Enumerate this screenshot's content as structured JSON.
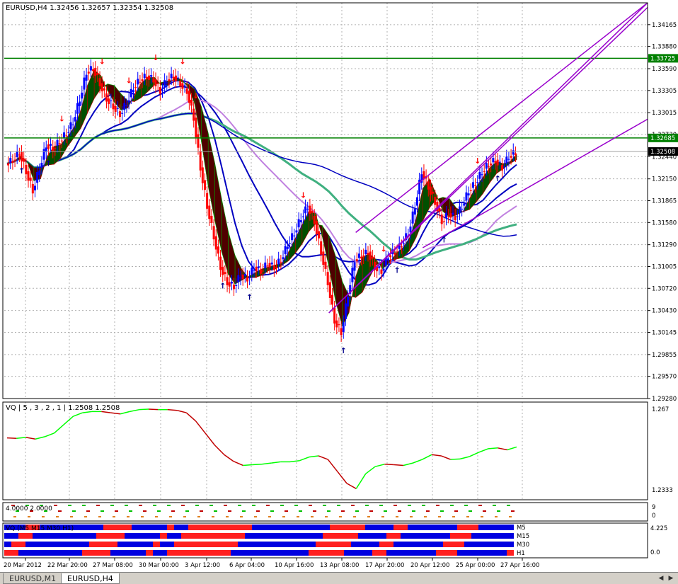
{
  "header": {
    "main_title": "EURUSD,H4  1.32456 1.32657 1.32354 1.32508",
    "vq_title": "VQ | 5 , 3 , 2 , 1 | 1.2508 1.2508",
    "dots_title": "4.0000 2.0000",
    "mtf_title": "VQ (M5 M15 M30 H1)"
  },
  "chart_data": {
    "type": "candlestick",
    "symbol": "EURUSD",
    "timeframe": "H4",
    "ohlc_last": {
      "open": 1.32456,
      "high": 1.32657,
      "low": 1.32354,
      "close": 1.32508
    },
    "y_ticks": [
      "1.34165",
      "1.33880",
      "1.33590",
      "1.33305",
      "1.33015",
      "1.32730",
      "1.32440",
      "1.32150",
      "1.31865",
      "1.31580",
      "1.31290",
      "1.31005",
      "1.30720",
      "1.30430",
      "1.30145",
      "1.29855",
      "1.29570",
      "1.29280"
    ],
    "y_range": [
      1.2928,
      1.3445
    ],
    "x_ticks": [
      "20 Mar 2012",
      "22 Mar 20:00",
      "27 Mar 08:00",
      "30 Mar 00:00",
      "3 Apr 12:00",
      "6 Apr 04:00",
      "10 Apr 16:00",
      "13 Apr 08:00",
      "17 Apr 20:00",
      "20 Apr 12:00",
      "25 Apr 00:00",
      "27 Apr 16:00"
    ],
    "close_path": [
      1.3235,
      1.324,
      1.325,
      1.3225,
      1.32,
      1.323,
      1.326,
      1.3255,
      1.3265,
      1.3275,
      1.329,
      1.332,
      1.3355,
      1.336,
      1.334,
      1.332,
      1.331,
      1.33,
      1.3315,
      1.3335,
      1.3345,
      1.335,
      1.3345,
      1.333,
      1.3345,
      1.335,
      1.334,
      1.333,
      1.3295,
      1.323,
      1.318,
      1.314,
      1.31,
      1.308,
      1.3075,
      1.309,
      1.3085,
      1.31,
      1.3095,
      1.3105,
      1.31,
      1.311,
      1.313,
      1.3145,
      1.3165,
      1.318,
      1.316,
      1.312,
      1.308,
      1.303,
      1.3015,
      1.3065,
      1.311,
      1.3115,
      1.312,
      1.31,
      1.3095,
      1.3115,
      1.312,
      1.313,
      1.3145,
      1.318,
      1.3225,
      1.3205,
      1.3185,
      1.316,
      1.317,
      1.3165,
      1.318,
      1.32,
      1.321,
      1.3225,
      1.3235,
      1.324,
      1.323,
      1.3245,
      1.325
    ],
    "horizontal_levels": [
      {
        "price": 1.33725,
        "label": "1.33725",
        "color": "#008000"
      },
      {
        "price": 1.32685,
        "label": "1.32685",
        "color": "#008000"
      }
    ],
    "current_price_label": "1.32508",
    "indicator_vq": {
      "y_ticks": [
        "1.267",
        "1.2333"
      ],
      "y_range": [
        1.2333,
        1.267
      ],
      "values": [
        1.255,
        1.2548,
        1.2552,
        1.2545,
        1.2555,
        1.257,
        1.2605,
        1.264,
        1.2655,
        1.266,
        1.266,
        1.2655,
        1.265,
        1.266,
        1.2668,
        1.267,
        1.2668,
        1.2668,
        1.2665,
        1.2655,
        1.262,
        1.257,
        1.252,
        1.248,
        1.2452,
        1.2435,
        1.2438,
        1.244,
        1.2445,
        1.245,
        1.245,
        1.2455,
        1.247,
        1.2475,
        1.246,
        1.241,
        1.236,
        1.2338,
        1.24,
        1.243,
        1.244,
        1.2438,
        1.2435,
        1.2445,
        1.246,
        1.248,
        1.2475,
        1.246,
        1.2462,
        1.2472,
        1.249,
        1.2505,
        1.2508,
        1.25,
        1.2512
      ]
    },
    "indicator_dots": {
      "y_ticks": [
        "9",
        "0"
      ]
    },
    "indicator_mtf": {
      "y_ticks": [
        "4.225",
        "0.0"
      ],
      "rows": [
        "M5",
        "M15",
        "M30",
        "H1"
      ]
    },
    "colors": {
      "bull": "#0000ff",
      "bear": "#ff0000",
      "cloud_bull": "#005000",
      "cloud_bear": "#500000",
      "vq_up": "#00ff00",
      "vq_down": "#c00000",
      "ma_blue": "#0000c0",
      "ma_purple": "#c080e0",
      "ma_green": "#40b080",
      "trend_line": "#9900cc",
      "level_line": "#008000",
      "grid": "#b0b0b0"
    }
  },
  "tabs": [
    {
      "label": "EURUSD,M1",
      "active": false
    },
    {
      "label": "EURUSD,H4",
      "active": true
    }
  ]
}
